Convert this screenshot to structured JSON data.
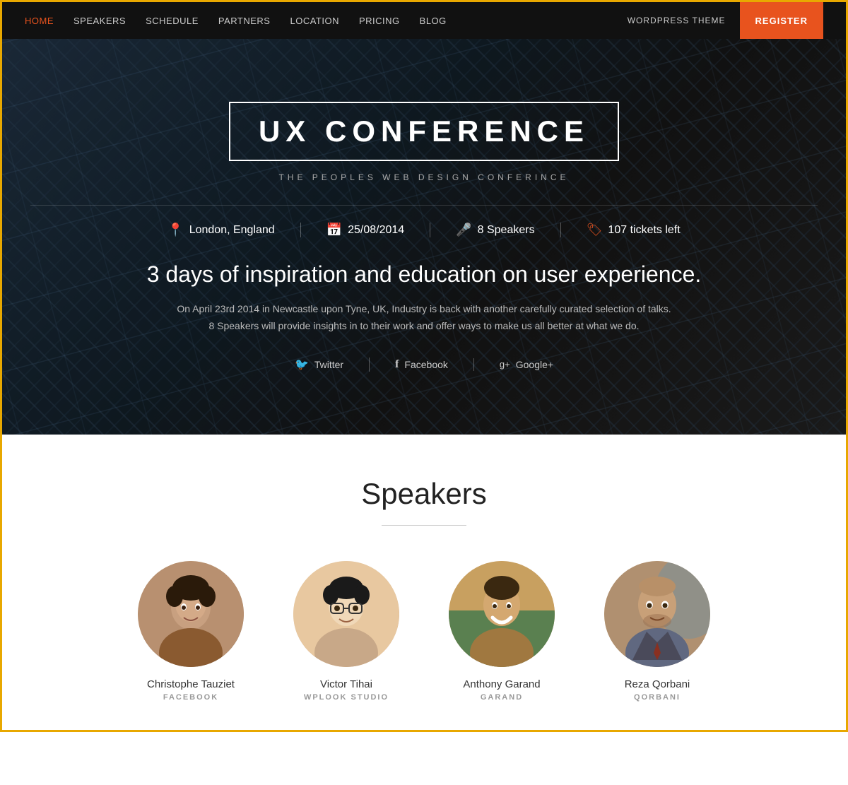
{
  "nav": {
    "links": [
      {
        "label": "HOME",
        "active": true
      },
      {
        "label": "SPEAKERS",
        "active": false
      },
      {
        "label": "SCHEDULE",
        "active": false
      },
      {
        "label": "PARTNERS",
        "active": false
      },
      {
        "label": "LOCATION",
        "active": false
      },
      {
        "label": "PRICING",
        "active": false
      },
      {
        "label": "BLOG",
        "active": false
      }
    ],
    "wordpress_theme": "WORDPRESS THEME",
    "register_label": "REGISTER"
  },
  "hero": {
    "title": "UX CONFERENCE",
    "subtitle": "THE PEOPLES WEB DESIGN CONFERINCE",
    "meta": [
      {
        "icon": "📍",
        "text": "London, England"
      },
      {
        "icon": "📅",
        "text": "25/08/2014"
      },
      {
        "icon": "🎤",
        "text": "8 Speakers"
      },
      {
        "icon": "🏷",
        "text": "107 tickets left"
      }
    ],
    "headline": "3 days of inspiration and education on user experience.",
    "description": "On April 23rd 2014 in Newcastle upon Tyne, UK, Industry is back with another carefully curated selection of talks. 8 Speakers will provide insights in to their work and offer ways to make us all better at what we do.",
    "social": [
      {
        "icon": "🐦",
        "label": "Twitter"
      },
      {
        "icon": "f",
        "label": "Facebook"
      },
      {
        "icon": "g+",
        "label": "Google+"
      }
    ]
  },
  "speakers": {
    "heading": "Speakers",
    "items": [
      {
        "name": "Christophe Tauziet",
        "company": "FACEBOOK"
      },
      {
        "name": "Victor Tihai",
        "company": "WPLOOK STUDIO"
      },
      {
        "name": "Anthony Garand",
        "company": "GARAND"
      },
      {
        "name": "Reza Qorbani",
        "company": "QORBANI"
      }
    ]
  }
}
